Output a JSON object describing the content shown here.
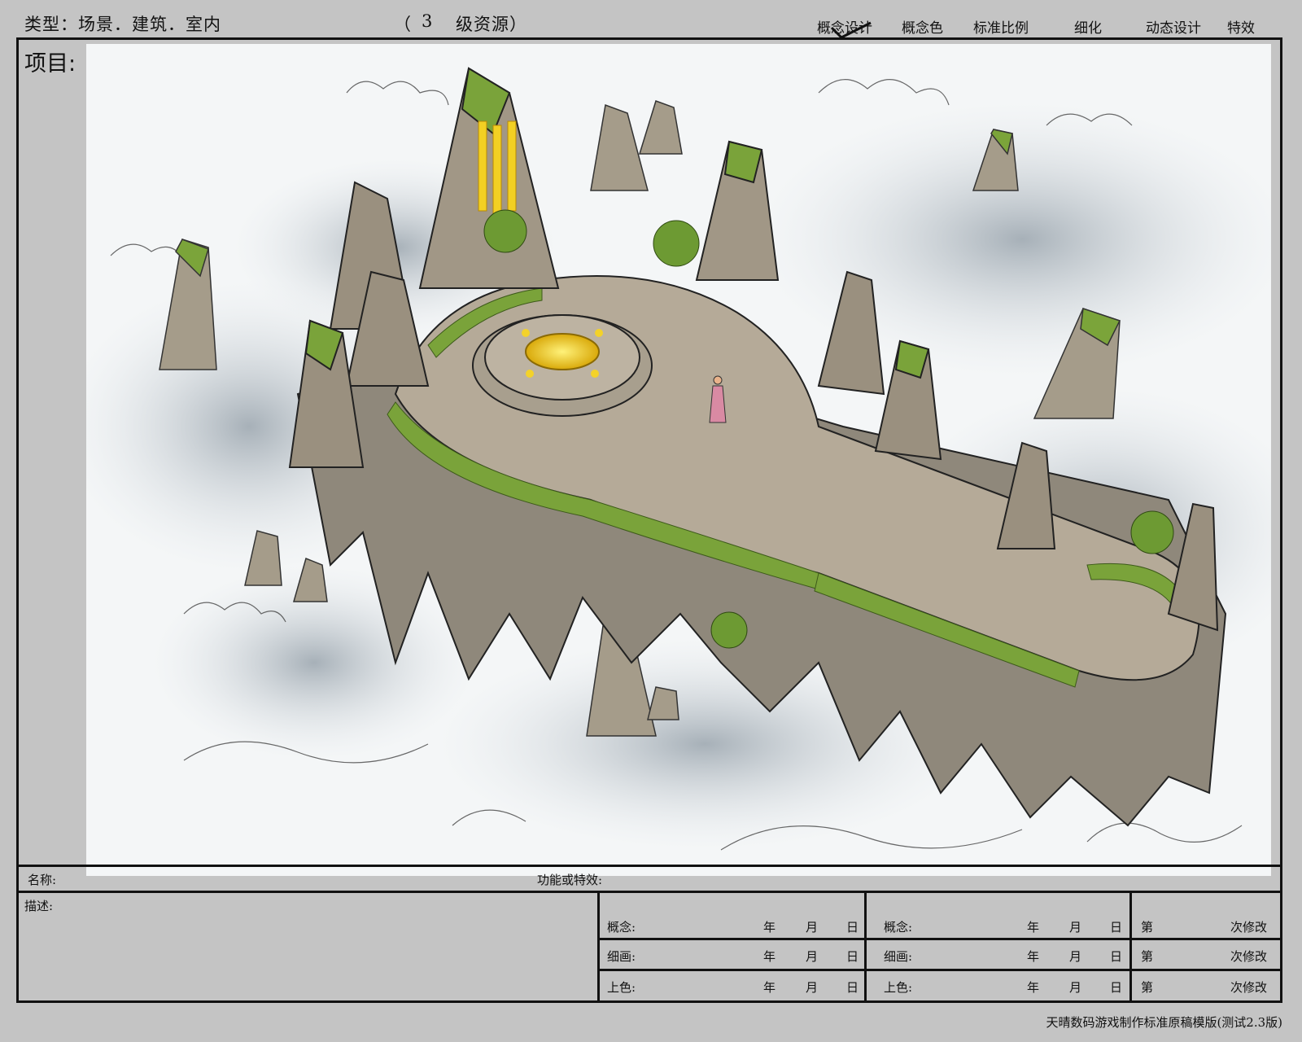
{
  "header": {
    "type_label": "类型：",
    "type_value": "场景．建筑．室内",
    "level_open": "（",
    "level_number": "3",
    "level_label": "级资源）",
    "steps": [
      "概念设计",
      "概念色",
      "标准比例",
      "细化",
      "动态设计",
      "特效"
    ]
  },
  "project_label": "项目:",
  "artwork": {
    "description": "floating mountain island above clouds"
  },
  "name_row": {
    "name_label": "名称:",
    "function_label": "功能或特效:"
  },
  "description_label": "描述:",
  "schedule": {
    "rows": [
      {
        "label": "概念:",
        "year": "年",
        "month": "月",
        "day": "日",
        "label2": "概念:",
        "year2": "年",
        "month2": "月",
        "day2": "日",
        "rev_prefix": "第",
        "rev_suffix": "次修改"
      },
      {
        "label": "细画:",
        "year": "年",
        "month": "月",
        "day": "日",
        "label2": "细画:",
        "year2": "年",
        "month2": "月",
        "day2": "日",
        "rev_prefix": "第",
        "rev_suffix": "次修改"
      },
      {
        "label": "上色:",
        "year": "年",
        "month": "月",
        "day": "日",
        "label2": "上色:",
        "year2": "年",
        "month2": "月",
        "day2": "日",
        "rev_prefix": "第",
        "rev_suffix": "次修改"
      }
    ]
  },
  "footer": "天晴数码游戏制作标准原稿模版(测试2.3版)",
  "colors": {
    "background": "#c4c4c4",
    "rock": "#9a9284",
    "moss": "#7aa33a",
    "gold": "#e8c21a",
    "cloud": "#e9edf0"
  }
}
